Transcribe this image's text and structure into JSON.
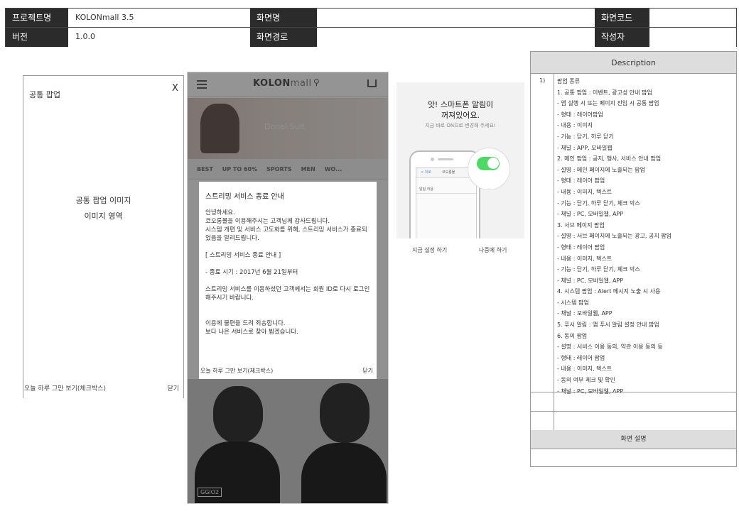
{
  "header": {
    "row1": [
      {
        "label": "프로젝트명",
        "value": "KOLONmall 3.5"
      },
      {
        "label": "화면명",
        "value": ""
      },
      {
        "label": "화면코드",
        "value": ""
      }
    ],
    "row2": [
      {
        "label": "버전",
        "value": "1.0.0"
      },
      {
        "label": "화면경로",
        "value": ""
      },
      {
        "label": "작성자",
        "value": ""
      }
    ]
  },
  "popup_sample": {
    "title": "공통 팝업",
    "close": "X",
    "body_line1": "공통 팝업 이미지",
    "body_line2": "이미지 영역",
    "footer_left": "오늘 하루 그만 보기(체크박스)",
    "footer_right": "닫기"
  },
  "mobile": {
    "logo_bold": "KOLON",
    "logo_light": "mall",
    "search_icon": "magnifier-icon",
    "banner_text": "Donel Suit",
    "categories": [
      "BEST",
      "UP TO 60%",
      "SPORTS",
      "MEN",
      "WO..."
    ],
    "photo_tag": "GGIO2",
    "modal": {
      "title": "스트리밍 서비스 종료 안내",
      "paragraphs": [
        "안녕하세요.\n코오롱몰을 이용해주시는 고객님께 감사드립니다.\n시스템 개편 및 서비스 고도화를 위해, 스트리밍 서비스가 종료되었음을 알려드립니다.",
        "[ 스트리밍 서비스 종료 안내 ]",
        "- 종료 시기 : 2017년 6월 21일부터",
        "스트리밍 서비스를 이용하셨던 고객께서는 회원 ID로 다시 로그인해주시기 바랍니다.",
        "이용에 불편을 드려 죄송합니다.\n보다 나은 서비스로 찾아 뵙겠습니다."
      ],
      "footer_left": "오늘 하루 그만 보기(체크박스)",
      "footer_right": "닫기"
    }
  },
  "alert": {
    "title_line1": "앗! 스마트폰 알림이",
    "title_line2": "꺼져있어요.",
    "subtitle": "지금 바로 ON으로 변경해 주세요!",
    "phone_back": "< 뒤로",
    "phone_title": "코오롱몰",
    "phone_row": "알림 허용",
    "btn_now": "지금 설정 하기",
    "btn_later": "나중에 하기"
  },
  "description": {
    "heading": "Description",
    "number": "1)",
    "lines": [
      "팝업 종류",
      "1. 공통 팝업 : 이벤트, 광고성 안내 팝업",
      "- 앱 실행 시 또는 페이지 진입 시 공통 팝업",
      "- 형태 : 레이어팝업",
      "- 내용 : 이미지",
      "- 기능 : 닫기, 하루 닫기",
      "- 채널 : APP, 모바일웹",
      "2. 메인 팝업 : 공지, 행사, 서비스 안내 팝업",
      "- 설명 : 메인 페이지에 노출되는 팝업",
      "- 형태 : 레이어 팝업",
      "- 내용 : 이미지, 텍스트",
      "- 기능 : 닫기, 하루 닫기, 체크 박스",
      "- 채널 : PC, 모바일웹, APP",
      "3. 서브 페이지 팝업",
      "- 설명 : 서브 페이지에 노출되는 광고, 공지 팝업",
      "- 형태 : 레이어 팝업",
      "- 내용 : 이미지, 텍스트",
      "- 기능 : 닫기, 하루 닫기, 체크 박스",
      "- 채널 : PC, 모바일웹, APP",
      "4. 시스템 팝업 : Alert 메시지 노출 시 사용",
      "- 시스템 팝업",
      "- 채널 : 모바일웹, APP",
      "5. 푸시 알림 : 앱 푸시 알림 설정 안내 팝업",
      "6. 동의 팝업",
      "- 설명 : 서비스 이용 동의, 약관 이용 동의 등",
      "- 형태 : 레이어 팝업",
      "- 내용 : 이미지, 텍스트",
      "- 동의 여부 체크 및 확인",
      "- 채널 : PC, 모바일웹, APP"
    ],
    "footer": "화면 설명"
  }
}
